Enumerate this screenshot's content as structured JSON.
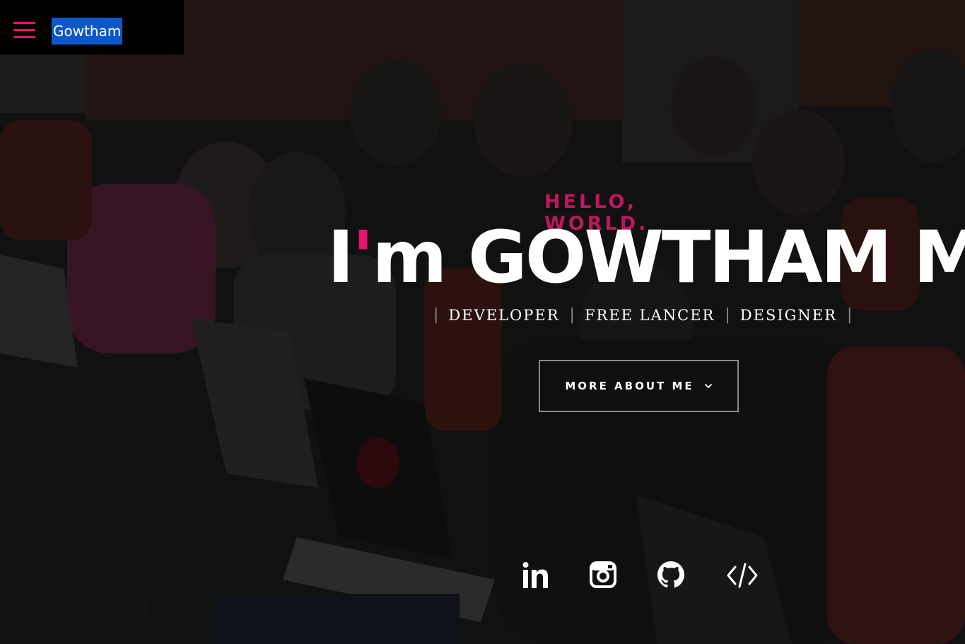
{
  "nav": {
    "logo_text": "Gowtham"
  },
  "hero": {
    "greeting": "HELLO, WORLD.",
    "headline_prefix": "I",
    "headline_apostrophe": "'",
    "headline_main": "m GOWTHAM M",
    "headline_dot": ".",
    "roles": [
      "DEVELOPER",
      "FREE LANCER",
      "DESIGNER"
    ],
    "role_separator": "|",
    "more_button_label": "MORE ABOUT ME"
  },
  "social": [
    {
      "icon": "linkedin-icon"
    },
    {
      "icon": "instagram-icon"
    },
    {
      "icon": "github-icon"
    },
    {
      "icon": "code-icon"
    }
  ],
  "colors": {
    "accent": "#e8126f",
    "greeting": "#c0175f",
    "logo_bg": "#0a58ca",
    "nav_bg": "#000000"
  }
}
